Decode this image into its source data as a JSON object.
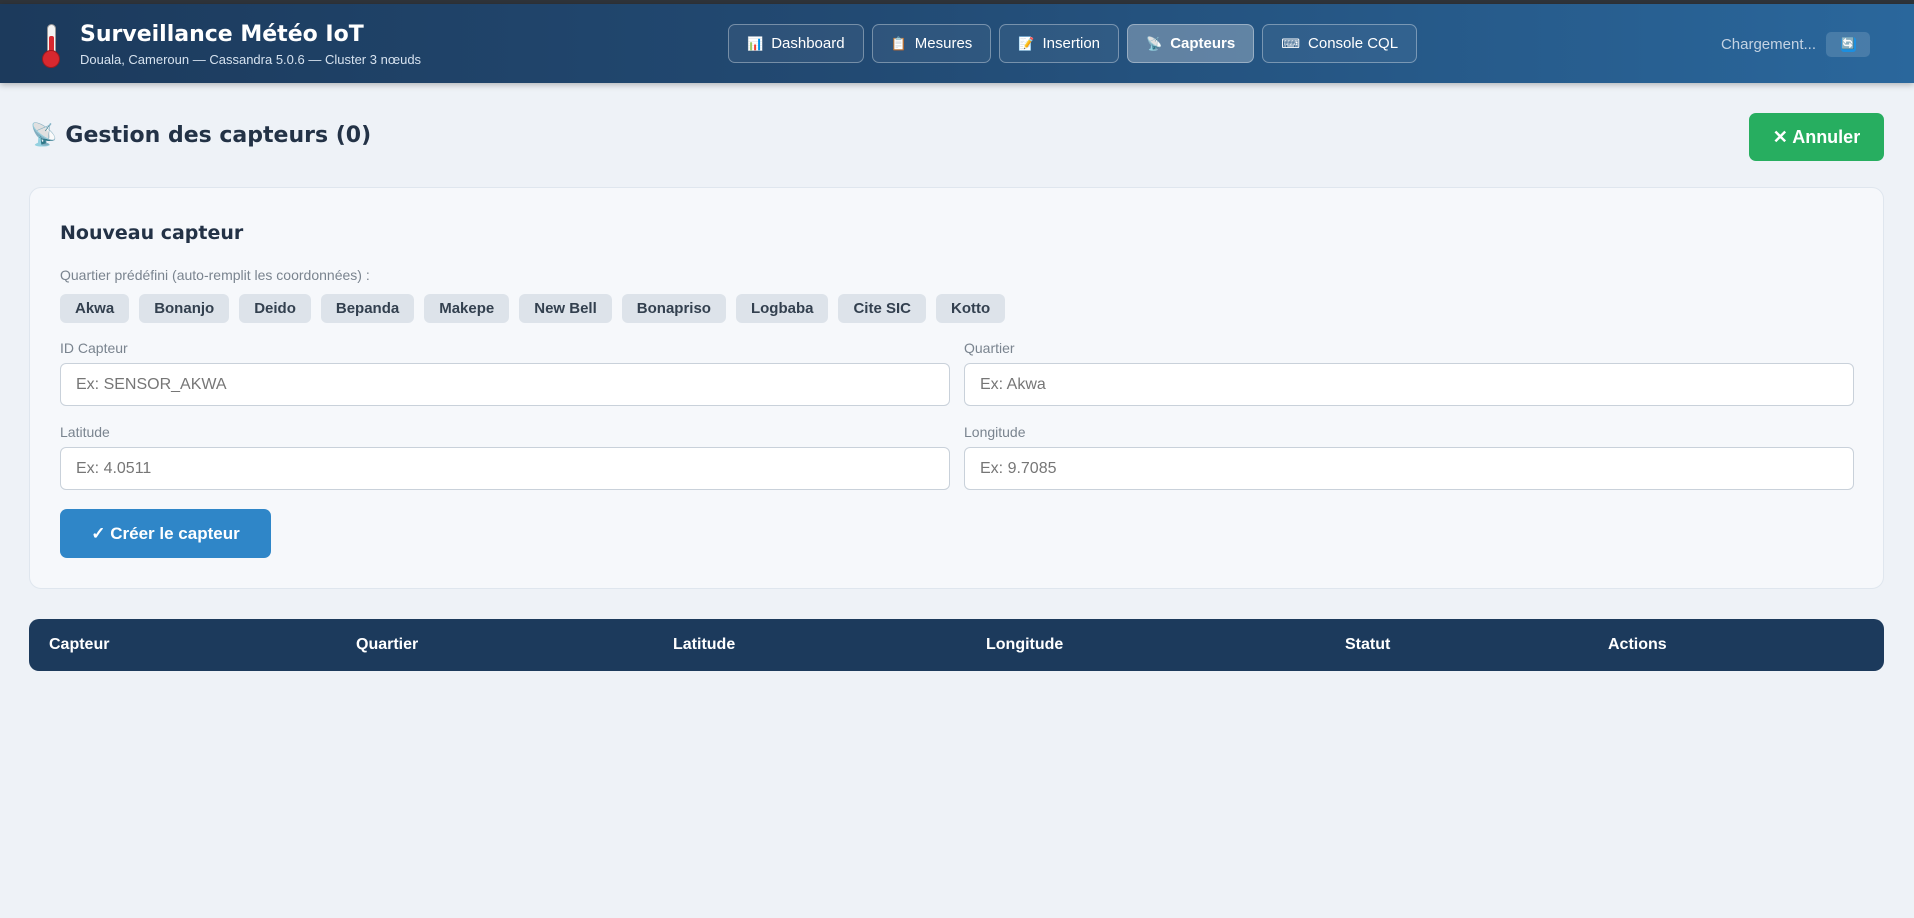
{
  "header": {
    "title": "Surveillance Météo IoT",
    "subtitle": "Douala, Cameroun — Cassandra 5.0.6 — Cluster 3 nœuds",
    "logo_icon": "thermometer-icon",
    "nav": [
      {
        "label": "Dashboard",
        "icon": "📊",
        "icon_name": "chart-icon",
        "active": false
      },
      {
        "label": "Mesures",
        "icon": "📋",
        "icon_name": "clipboard-icon",
        "active": false
      },
      {
        "label": "Insertion",
        "icon": "📝",
        "icon_name": "memo-icon",
        "active": false
      },
      {
        "label": "Capteurs",
        "icon": "📡",
        "icon_name": "satellite-dish-icon",
        "active": true
      },
      {
        "label": "Console CQL",
        "icon": "⌨",
        "icon_name": "keyboard-icon",
        "active": false
      }
    ],
    "loading_text": "Chargement...",
    "refresh_icon": "🔄"
  },
  "page": {
    "title": "Gestion des capteurs (0)",
    "title_icon": "📡",
    "cancel_label": "✕ Annuler"
  },
  "form": {
    "title": "Nouveau capteur",
    "preset_label": "Quartier prédéfini (auto-remplit les coordonnées) :",
    "presets": [
      "Akwa",
      "Bonanjo",
      "Deido",
      "Bepanda",
      "Makepe",
      "New Bell",
      "Bonapriso",
      "Logbaba",
      "Cite SIC",
      "Kotto"
    ],
    "id_label": "ID Capteur",
    "id_placeholder": "Ex: SENSOR_AKWA",
    "quartier_label": "Quartier",
    "quartier_placeholder": "Ex: Akwa",
    "lat_label": "Latitude",
    "lat_placeholder": "Ex: 4.0511",
    "lon_label": "Longitude",
    "lon_placeholder": "Ex: 9.7085",
    "submit_label": "✓ Créer le capteur"
  },
  "table": {
    "columns": [
      "Capteur",
      "Quartier",
      "Latitude",
      "Longitude",
      "Statut",
      "Actions"
    ],
    "rows": []
  },
  "colors": {
    "header_dark": "#1c3a5c",
    "accent_green": "#27ae60",
    "accent_blue": "#2f86c8",
    "background": "#eef2f7"
  }
}
